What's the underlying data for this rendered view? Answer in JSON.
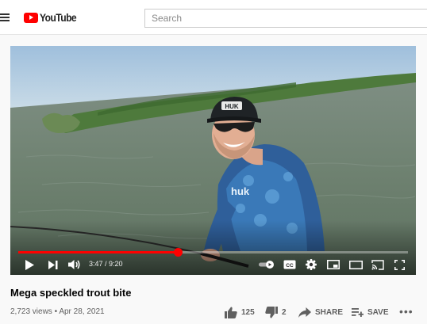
{
  "header": {
    "logo_text": "YouTube",
    "search_placeholder": "Search"
  },
  "player": {
    "current_time": "3:47",
    "duration": "9:20",
    "time_display": "3:47 / 9:20",
    "progress_fraction": 0.41,
    "accent_color": "#ff0000",
    "icons": [
      "play-icon",
      "next-icon",
      "volume-icon",
      "autoplay-toggle",
      "subtitles-icon",
      "settings-icon",
      "miniplayer-icon",
      "theater-icon",
      "cast-icon",
      "fullscreen-icon"
    ],
    "cap_text": "HUK",
    "shirt_text": "huk"
  },
  "video": {
    "title": "Mega speckled trout bite",
    "views": "2,723 views",
    "date": "Apr 28, 2021",
    "meta": "2,723 views • Apr 28, 2021"
  },
  "actions": {
    "likes": "125",
    "dislikes": "2",
    "share_label": "SHARE",
    "save_label": "SAVE",
    "more_label": "•••"
  }
}
